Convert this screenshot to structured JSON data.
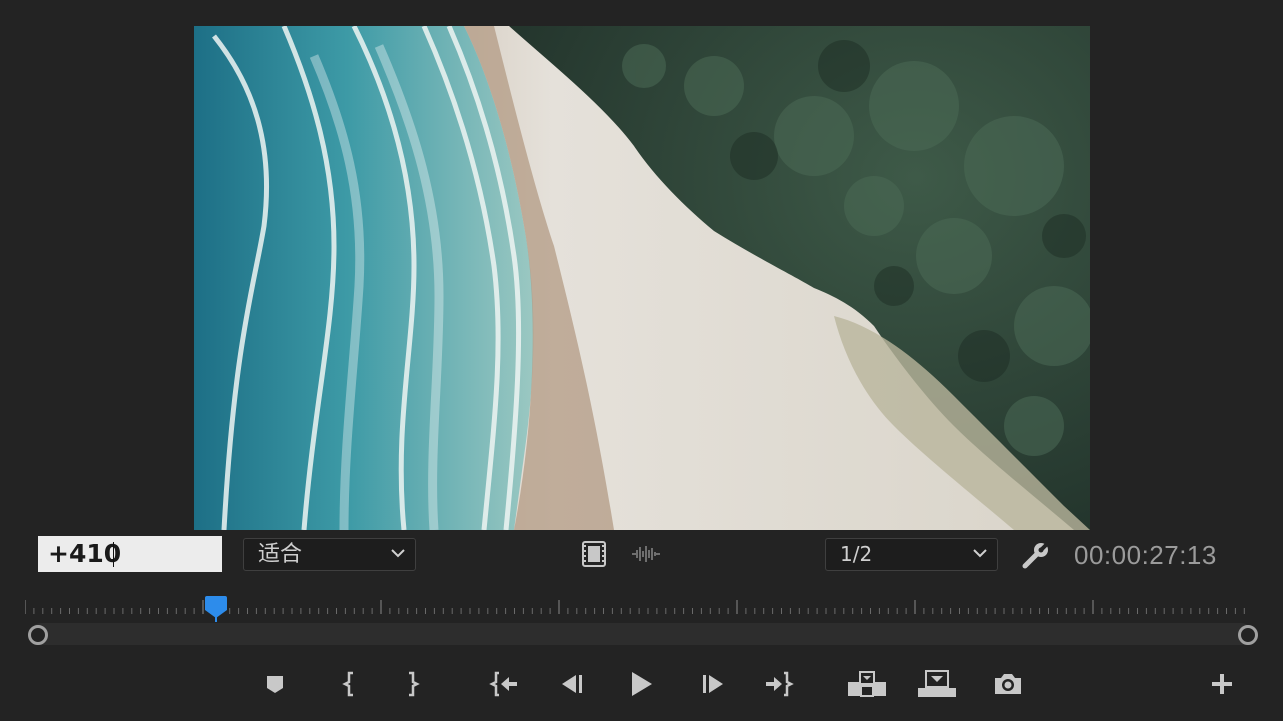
{
  "monitor": {
    "timecode_entry": "+410",
    "zoom_level": "适合",
    "resolution": "1/2",
    "current_timecode": "00:00:27:13",
    "playhead_position_fraction": 0.156
  },
  "icons": {
    "compare": "film-strip-icon",
    "audio": "waveform-icon",
    "settings": "wrench-icon",
    "chevron": "chevron-down-icon",
    "add": "plus-icon"
  },
  "transport_buttons": [
    "add-marker",
    "mark-in",
    "mark-out",
    "go-to-in",
    "step-back",
    "play",
    "step-forward",
    "go-to-out",
    "insert",
    "overwrite",
    "export-frame"
  ],
  "colors": {
    "background": "#232323",
    "accent": "#2d8ceb",
    "icon": "#c8c8c8"
  }
}
